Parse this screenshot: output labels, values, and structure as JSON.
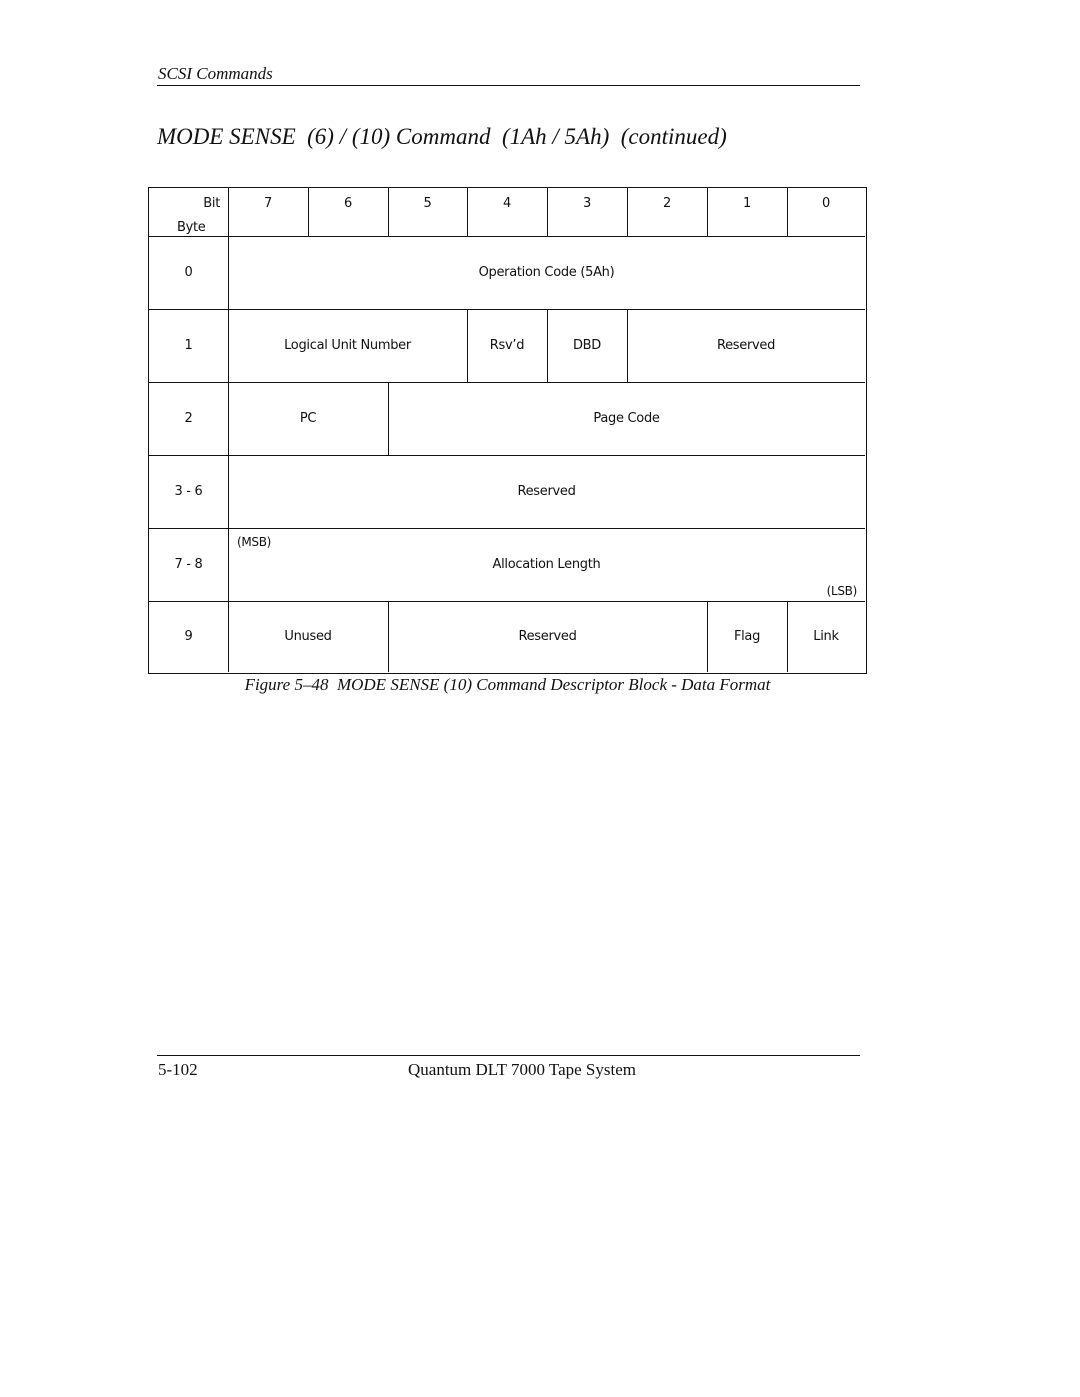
{
  "header": {
    "section": "SCSI Commands"
  },
  "title": "MODE SENSE  (6) / (10) Command  (1Ah / 5Ah)  (continued)",
  "cdb_table": {
    "corner_bit_label": "Bit",
    "corner_byte_label": "Byte",
    "bit_headers": [
      "7",
      "6",
      "5",
      "4",
      "3",
      "2",
      "1",
      "0"
    ],
    "rows": [
      {
        "byte": "0",
        "fields": [
          {
            "label": "Operation Code (5Ah)",
            "bits": "7-0"
          }
        ]
      },
      {
        "byte": "1",
        "fields": [
          {
            "label": "Logical Unit Number",
            "bits": "7-5"
          },
          {
            "label": "Rsv’d",
            "bits": "4"
          },
          {
            "label": "DBD",
            "bits": "3"
          },
          {
            "label": "Reserved",
            "bits": "2-0"
          }
        ]
      },
      {
        "byte": "2",
        "fields": [
          {
            "label": "PC",
            "bits": "7-6"
          },
          {
            "label": "Page Code",
            "bits": "5-0"
          }
        ]
      },
      {
        "byte": "3 - 6",
        "fields": [
          {
            "label": "Reserved",
            "bits": "7-0"
          }
        ]
      },
      {
        "byte": "7 - 8",
        "fields": [
          {
            "label": "Allocation Length",
            "bits": "7-0",
            "msb": "(MSB)",
            "lsb": "(LSB)"
          }
        ]
      },
      {
        "byte": "9",
        "fields": [
          {
            "label": "Unused",
            "bits": "7-6"
          },
          {
            "label": "Reserved",
            "bits": "5-2"
          },
          {
            "label": "Flag",
            "bits": "1"
          },
          {
            "label": "Link",
            "bits": "0"
          }
        ]
      }
    ]
  },
  "caption": "Figure 5–48  MODE SENSE (10) Command Descriptor Block - Data Format",
  "footer": {
    "page_number": "5-102",
    "document_title": "Quantum DLT 7000 Tape System"
  }
}
